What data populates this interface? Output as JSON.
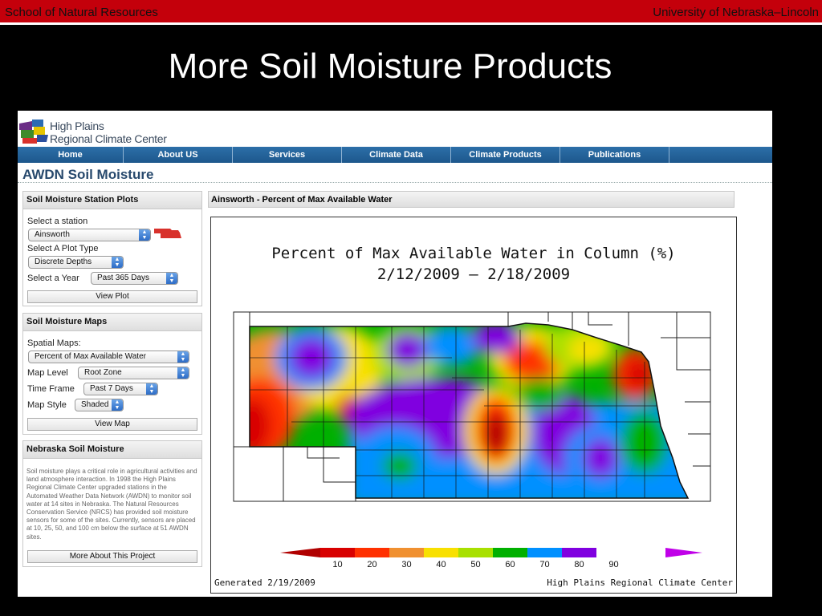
{
  "slide": {
    "header_left": "School of Natural Resources",
    "header_right": "University of Nebraska–Lincoln",
    "title": "More Soil Moisture Products"
  },
  "site": {
    "logo_line1": "High Plains",
    "logo_line2": "Regional Climate Center",
    "nav": [
      "Home",
      "About US",
      "Services",
      "Climate Data",
      "Climate Products",
      "Publications"
    ],
    "page_title": "AWDN Soil Moisture"
  },
  "station_plots": {
    "heading": "Soil Moisture Station Plots",
    "station_label": "Select a station",
    "station_value": "Ainsworth",
    "plot_type_label": "Select A Plot Type",
    "plot_type_value": "Discrete Depths",
    "year_label": "Select a Year",
    "year_value": "Past 365 Days",
    "button": "View Plot"
  },
  "maps": {
    "heading": "Soil Moisture Maps",
    "spatial_label": "Spatial Maps:",
    "spatial_value": "Percent of Max Available Water",
    "level_label": "Map Level",
    "level_value": "Root Zone",
    "timeframe_label": "Time Frame",
    "timeframe_value": "Past 7 Days",
    "style_label": "Map Style",
    "style_value": "Shaded",
    "button": "View Map"
  },
  "nebraska": {
    "heading": "Nebraska Soil Moisture",
    "text": "Soil moisture plays a critical role in agricultural activities and land atmosphere interaction. In 1998 the High Plains Regional Climate Center upgraded stations in the Automated Weather Data Network (AWDN) to monitor soil water at 14 sites in Nebraska. The Natural Resources Conservation Service (NRCS) has provided soil moisture sensors for some of the sites. Currently, sensors are placed at 10, 25, 50, and 100 cm below the surface at 51 AWDN sites.",
    "button": "More About This Project"
  },
  "map": {
    "panel_heading": "Ainsworth - Percent of Max Available Water",
    "title_line1": "Percent of Max Available Water in Column (%)",
    "title_line2": "2/12/2009 – 2/18/2009",
    "generated": "Generated 2/19/2009",
    "credit": "High Plains Regional Climate Center",
    "legend": {
      "labels": [
        "10",
        "20",
        "30",
        "40",
        "50",
        "60",
        "70",
        "80",
        "90"
      ],
      "colors": [
        "#b00000",
        "#d80000",
        "#ff3000",
        "#f09030",
        "#f8e000",
        "#a8e000",
        "#00b000",
        "#0090ff",
        "#8000e0",
        "#c000e8"
      ]
    }
  }
}
